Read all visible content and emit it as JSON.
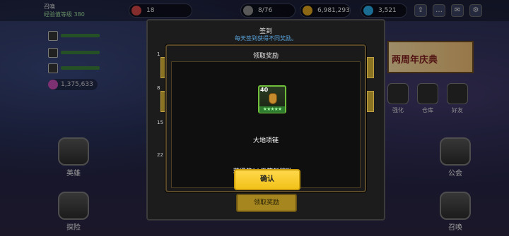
{
  "player": {
    "name": "召唤",
    "exp_text": "经验值等级 380"
  },
  "resources": {
    "stamina": "8/76",
    "gold": "6,981,293",
    "gems": "3,521",
    "level_badge": "18"
  },
  "crystal_count": "1,375,633",
  "banner_text": "两周年庆典",
  "right_menu": [
    "强化",
    "仓库",
    "好友"
  ],
  "side_left": [
    "英雄",
    "探险"
  ],
  "side_right": [
    "公会",
    "召唤"
  ],
  "checkin_panel": {
    "title": "签到",
    "subtitle": "每天签到获得不同奖励。",
    "row_labels": [
      "1",
      "8",
      "15",
      "22"
    ],
    "claim_button": "领取奖励"
  },
  "modal": {
    "title": "领取奖励",
    "item": {
      "level": "40",
      "name": "大地项链",
      "stars": "★★★★★"
    },
    "message": "获得第21天签到奖励。",
    "confirm_button": "确认"
  },
  "colors": {
    "confirm": "#f2c21a",
    "accent_blue": "#5aa6e0",
    "rarity_green": "#6fbf3a"
  }
}
